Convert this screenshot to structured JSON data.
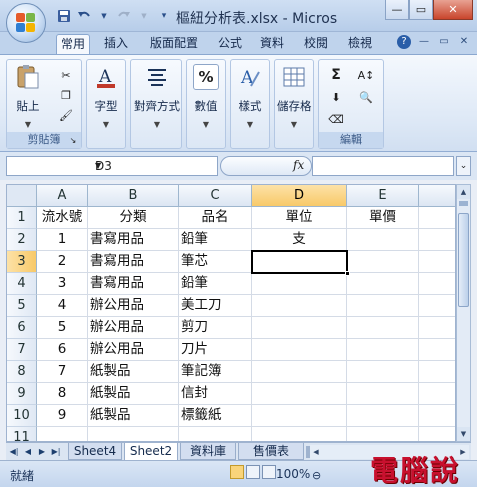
{
  "window": {
    "title": "樞紐分析表.xlsx - Micros",
    "controls": {
      "minimize": "—",
      "maximize": "▭",
      "close": "✕"
    }
  },
  "quick_access": {
    "icons": [
      "save-icon",
      "undo-icon",
      "redo-icon",
      "customize-qat-icon"
    ]
  },
  "ribbon_tabs": [
    "常用",
    "插入",
    "版面配置",
    "公式",
    "資料",
    "校閱",
    "檢視"
  ],
  "active_tab": "常用",
  "ribbon": {
    "groups": [
      {
        "name": "剪貼簿",
        "buttons": [
          "貼上"
        ]
      },
      {
        "name": "",
        "buttons": [
          "字型"
        ]
      },
      {
        "name": "",
        "buttons": [
          "對齊方式"
        ]
      },
      {
        "name": "",
        "buttons": [
          "數值"
        ]
      },
      {
        "name": "",
        "buttons": [
          "樣式"
        ]
      },
      {
        "name": "",
        "buttons": [
          "儲存格"
        ]
      },
      {
        "name": "編輯",
        "buttons": []
      }
    ],
    "clipboard_label": "剪貼簿",
    "paste_label": "貼上",
    "font_label": "字型",
    "align_label": "對齊方式",
    "number_label": "數值",
    "styles_label": "樣式",
    "cells_label": "儲存格",
    "editing_label": "編輯",
    "font_color": "#c0392b",
    "number_symbol": "%",
    "sum_symbol": "Σ"
  },
  "formula_bar": {
    "name_box": "D3",
    "fx_label": "fx",
    "formula": ""
  },
  "sheet": {
    "columns": [
      "A",
      "B",
      "C",
      "D",
      "E"
    ],
    "selected_column": "D",
    "selected_row": "3",
    "active_cell": "D3",
    "rows": [
      {
        "num": "1",
        "cells": [
          "流水號",
          "分類",
          "品名",
          "單位",
          "單價"
        ]
      },
      {
        "num": "2",
        "cells": [
          "1",
          "書寫用品",
          "鉛筆",
          "支",
          ""
        ]
      },
      {
        "num": "3",
        "cells": [
          "2",
          "書寫用品",
          "筆芯",
          "",
          ""
        ]
      },
      {
        "num": "4",
        "cells": [
          "3",
          "書寫用品",
          "鉛筆",
          "",
          ""
        ]
      },
      {
        "num": "5",
        "cells": [
          "4",
          "辦公用品",
          "美工刀",
          "",
          ""
        ]
      },
      {
        "num": "6",
        "cells": [
          "5",
          "辦公用品",
          "剪刀",
          "",
          ""
        ]
      },
      {
        "num": "7",
        "cells": [
          "6",
          "辦公用品",
          "刀片",
          "",
          ""
        ]
      },
      {
        "num": "8",
        "cells": [
          "7",
          "紙製品",
          "筆記簿",
          "",
          ""
        ]
      },
      {
        "num": "9",
        "cells": [
          "8",
          "紙製品",
          "信封",
          "",
          ""
        ]
      },
      {
        "num": "10",
        "cells": [
          "9",
          "紙製品",
          "標籤紙",
          "",
          ""
        ]
      },
      {
        "num": "11",
        "cells": [
          "",
          "",
          "",
          "",
          ""
        ]
      }
    ]
  },
  "sheet_tabs": [
    "Sheet4",
    "Sheet2",
    "資料庫",
    "售價表"
  ],
  "active_sheet": "Sheet2",
  "status_bar": {
    "mode": "就緒",
    "zoom": "100%",
    "zoom_out": "⊖"
  },
  "watermark": "電腦說",
  "colors": {
    "ribbon_bg": "#dde8f6",
    "selected_header": "#f8c969",
    "grid_line": "#d4dbe6",
    "watermark": "#c8102e"
  }
}
